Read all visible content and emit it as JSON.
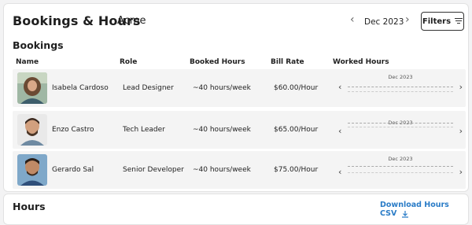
{
  "header": {
    "title": "Bookings & Hours",
    "company": "Acme",
    "month": "Dec 2023",
    "filters_label": "Filters"
  },
  "bookings": {
    "title": "Bookings",
    "columns": [
      "Name",
      "Role",
      "Booked Hours",
      "Bill Rate",
      "Worked Hours"
    ],
    "rows": [
      {
        "name": "Isabela Cardoso",
        "role": "Lead Designer",
        "booked": "~40 hours/week",
        "rate": "$60.00/Hour",
        "worked_month": "Dec 2023"
      },
      {
        "name": "Enzo Castro",
        "role": "Tech Leader",
        "booked": "~40 hours/week",
        "rate": "$65.00/Hour",
        "worked_month": "Dec 2023"
      },
      {
        "name": "Gerardo Sal",
        "role": "Senior Developer",
        "booked": "~40 hours/week",
        "rate": "$75.00/Hour",
        "worked_month": "Dec 2023"
      }
    ]
  },
  "hours": {
    "title": "Hours",
    "download_label": "Download Hours CSV"
  },
  "colors": {
    "accent": "#2a7cc7"
  }
}
